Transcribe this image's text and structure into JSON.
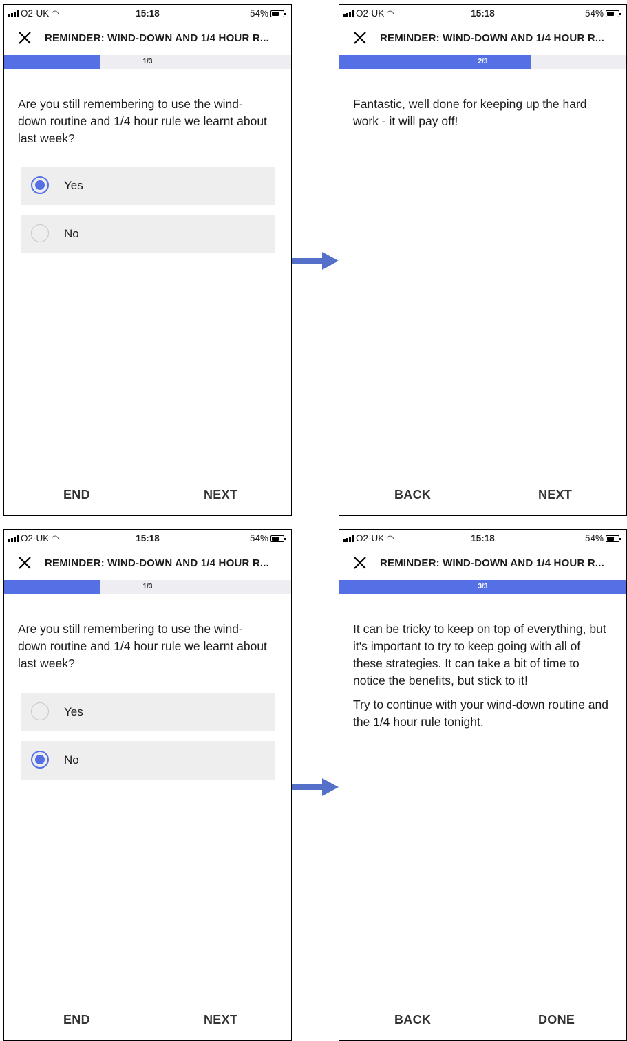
{
  "status": {
    "carrier": "O2-UK",
    "time": "15:18",
    "battery": "54%"
  },
  "title": "REMINDER: WIND-DOWN AND 1/4 HOUR R...",
  "colors": {
    "accent": "#5570e5",
    "option_bg": "#eeeeee",
    "progress_track": "#eeeef2"
  },
  "screens": [
    {
      "progress_label": "1/3",
      "progress_fraction": 0.333,
      "question": "Are you still remembering to use the wind-down routine and 1/4 hour rule we learnt about last week?",
      "options": [
        {
          "label": "Yes",
          "selected": true
        },
        {
          "label": "No",
          "selected": false
        }
      ],
      "footer_left": "END",
      "footer_right": "NEXT"
    },
    {
      "progress_label": "2/3",
      "progress_fraction": 0.667,
      "paragraphs": [
        "Fantastic, well done for keeping up the hard work - it will pay off!"
      ],
      "footer_left": "BACK",
      "footer_right": "NEXT"
    },
    {
      "progress_label": "1/3",
      "progress_fraction": 0.333,
      "question": "Are you still remembering to use the wind-down routine and 1/4 hour rule we learnt about last week?",
      "options": [
        {
          "label": "Yes",
          "selected": false
        },
        {
          "label": "No",
          "selected": true
        }
      ],
      "footer_left": "END",
      "footer_right": "NEXT"
    },
    {
      "progress_label": "3/3",
      "progress_fraction": 1.0,
      "paragraphs": [
        "It can be tricky to keep on top of everything, but it's important to try to keep going with all of these strategies. It can take a bit of time to notice the benefits, but stick to it!",
        "Try to continue with your wind-down routine and the 1/4 hour rule tonight."
      ],
      "footer_left": "BACK",
      "footer_right": "DONE"
    }
  ]
}
